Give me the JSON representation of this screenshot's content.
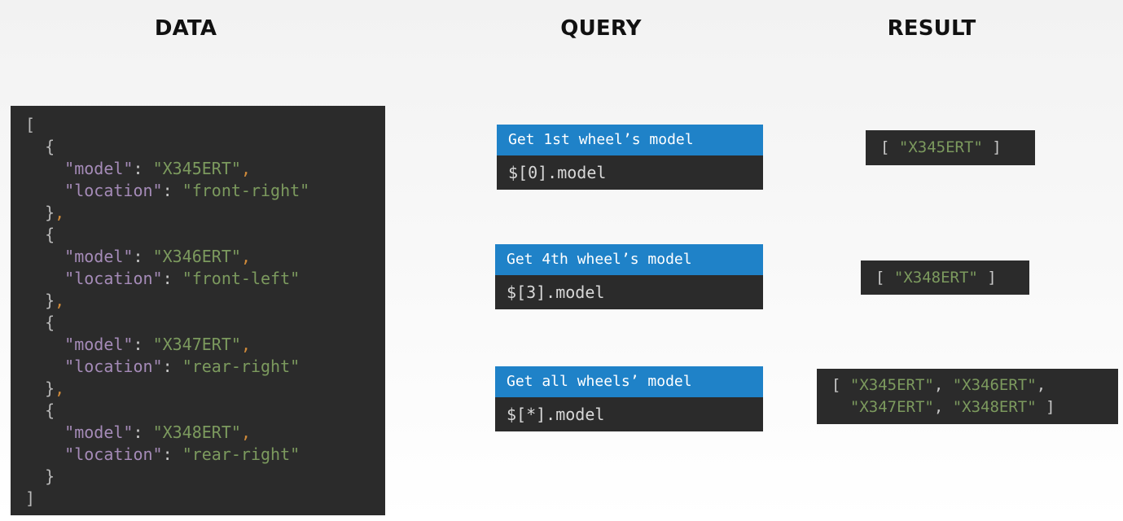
{
  "headings": {
    "data": "DATA",
    "query": "QUERY",
    "result": "RESULT"
  },
  "json_lines": [
    "[",
    "  {",
    "    \"model\": \"X345ERT\",",
    "    \"location\": \"front-right\"",
    "  },",
    "  {",
    "    \"model\": \"X346ERT\",",
    "    \"location\": \"front-left\"",
    "  },",
    "  {",
    "    \"model\": \"X347ERT\",",
    "    \"location\": \"rear-right\"",
    "  },",
    "  {",
    "    \"model\": \"X348ERT\",",
    "    \"location\": \"rear-right\"",
    "  }",
    "]"
  ],
  "queries": [
    {
      "title": "Get 1st wheel’s model",
      "expression": "$[0].model"
    },
    {
      "title": "Get 4th wheel’s model",
      "expression": "$[3].model"
    },
    {
      "title": "Get all wheels’ model",
      "expression": "$[*].model"
    }
  ],
  "results": [
    {
      "lines": [
        "[ \"X345ERT\" ]"
      ]
    },
    {
      "lines": [
        "[ \"X348ERT\" ]"
      ]
    },
    {
      "lines": [
        "[ \"X345ERT\", \"X346ERT\",",
        "  \"X347ERT\", \"X348ERT\" ]"
      ]
    }
  ],
  "colors": {
    "code_bg": "#2b2b2b",
    "query_title_bg": "#1f82c8",
    "json_key": "#a58bb8",
    "json_string": "#7c9a5e",
    "json_comma": "#cf8a3a"
  }
}
